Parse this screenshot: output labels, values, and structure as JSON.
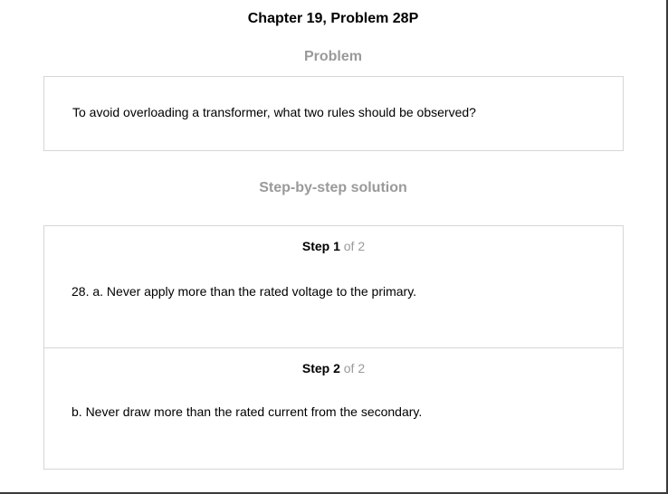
{
  "header": {
    "title": "Chapter 19, Problem 28P"
  },
  "problem": {
    "heading": "Problem",
    "text": "To avoid overloading a transformer, what two rules should be observed?"
  },
  "solution": {
    "heading": "Step-by-step solution",
    "steps": [
      {
        "label": "Step 1",
        "of": "of 2",
        "text": "28. a. Never apply more than the rated voltage to the primary."
      },
      {
        "label": "Step 2",
        "of": "of 2",
        "text": "b. Never draw more than the rated current from the secondary."
      }
    ]
  }
}
